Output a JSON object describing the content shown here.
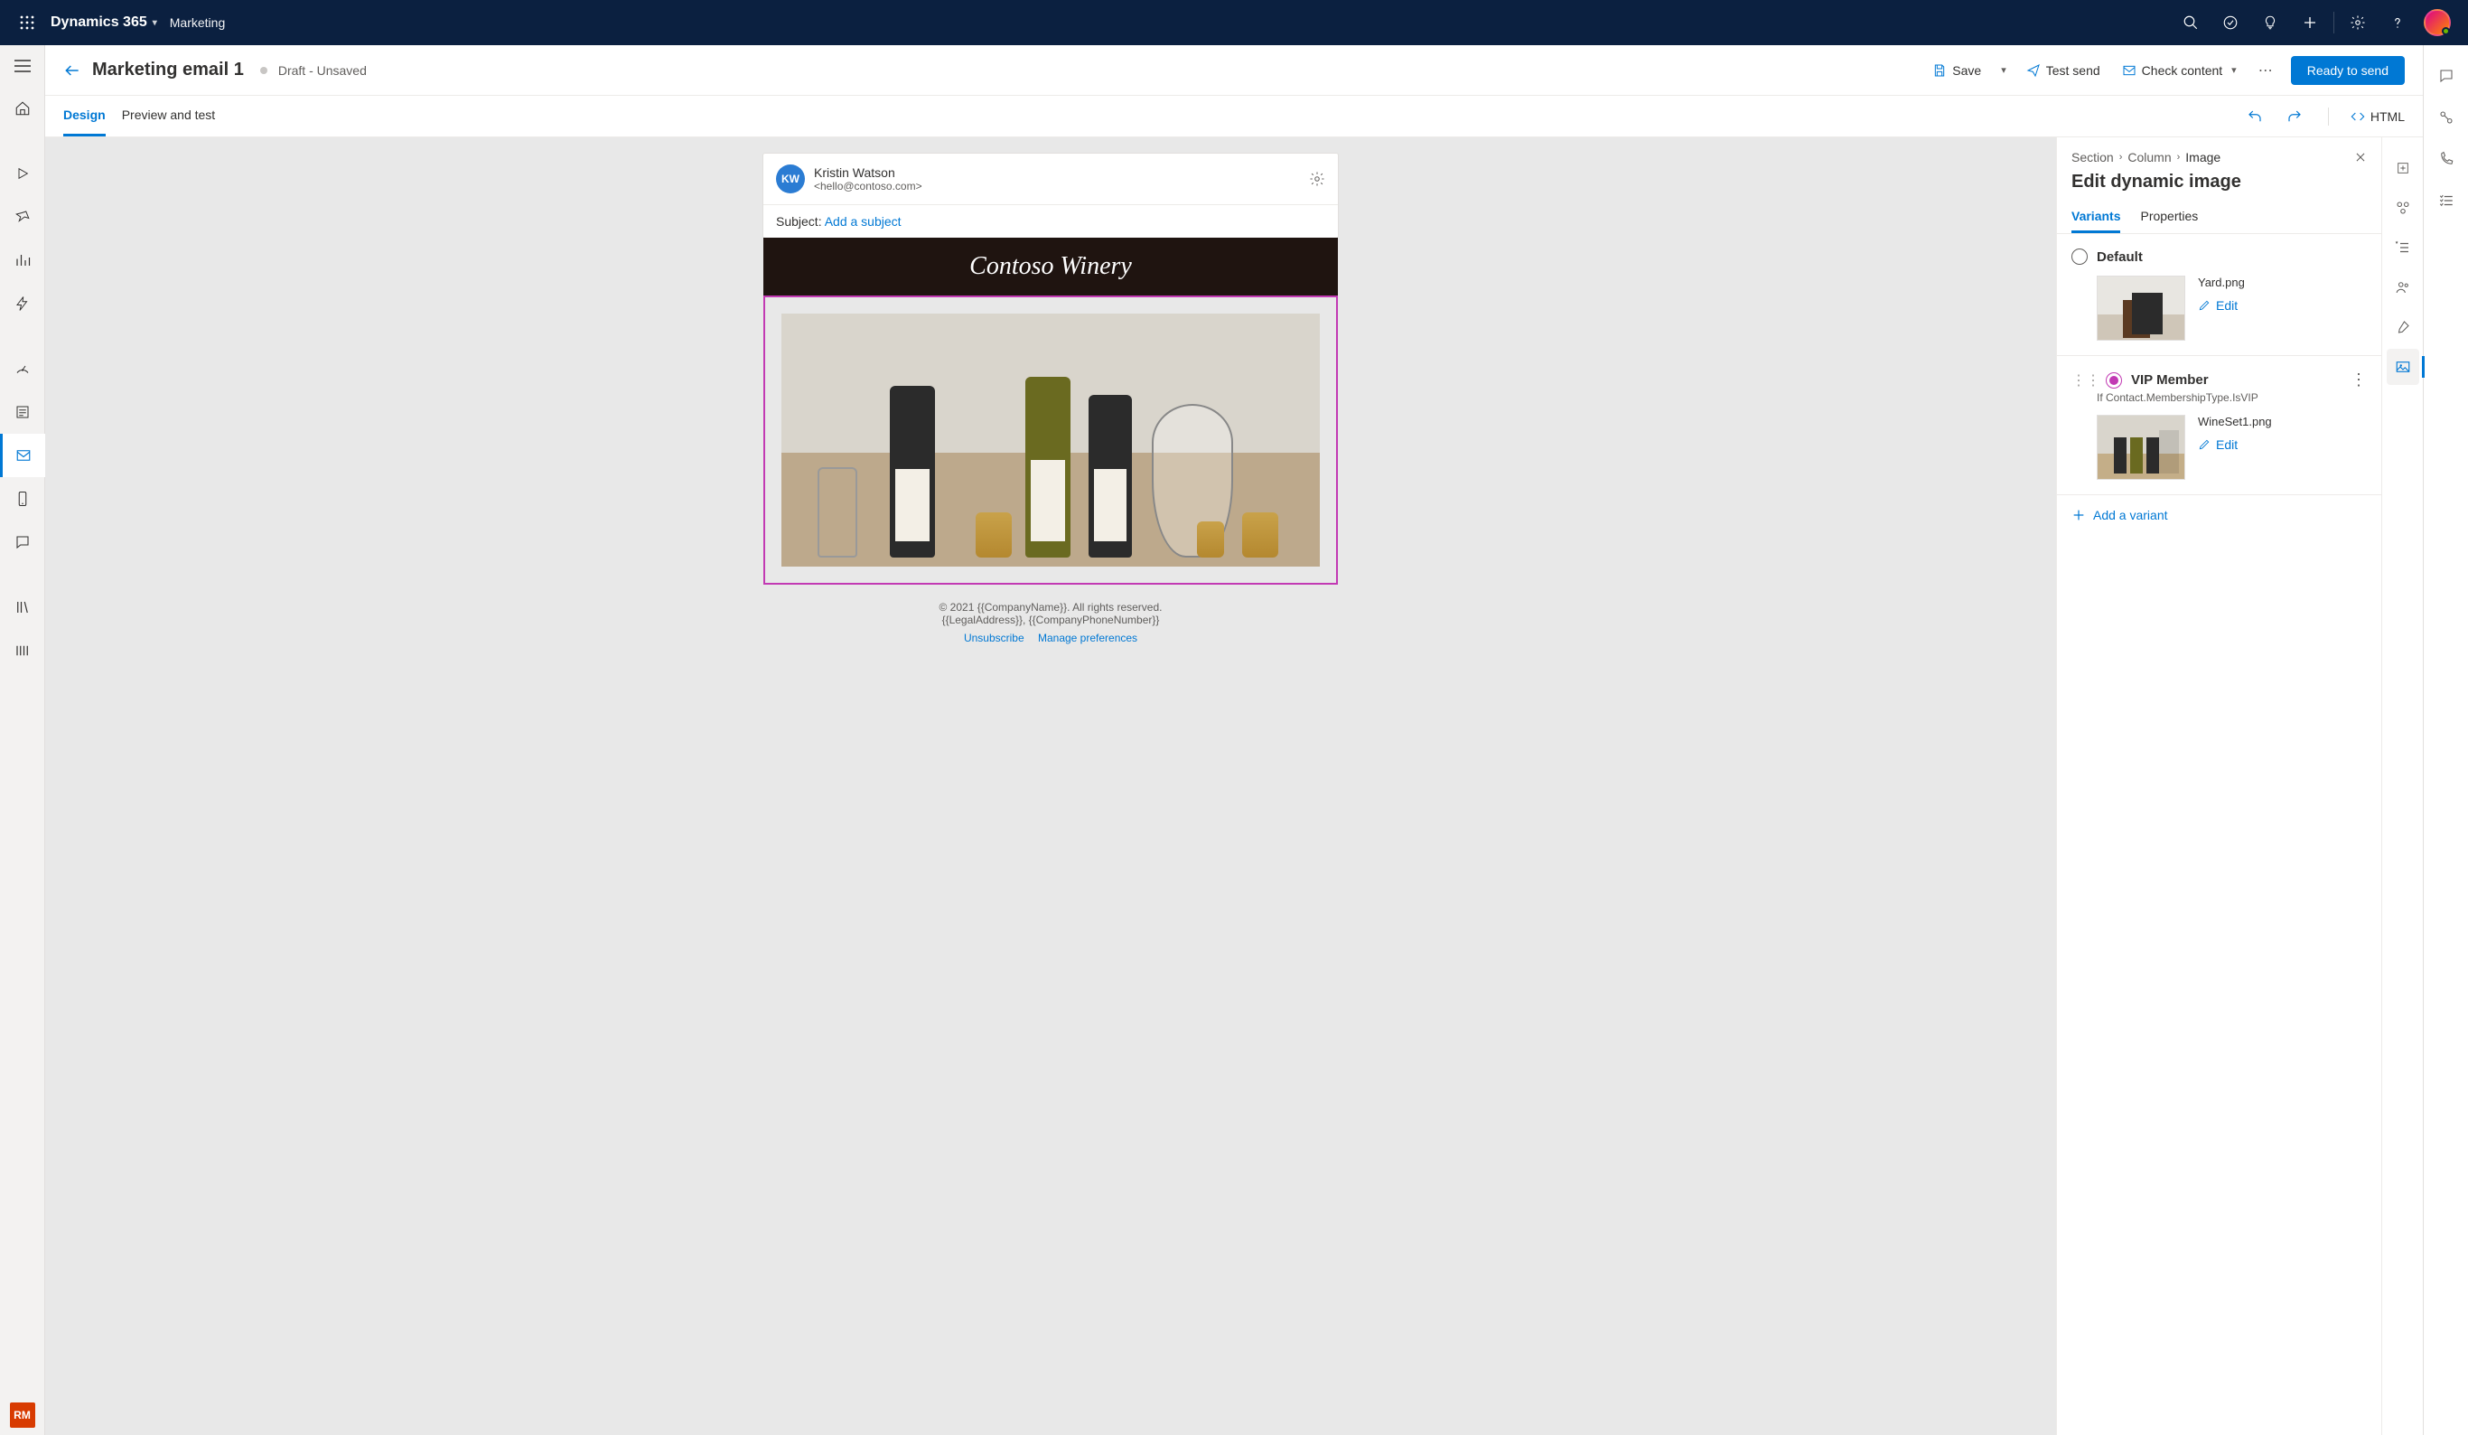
{
  "topnav": {
    "brand": "Dynamics 365",
    "area": "Marketing"
  },
  "leftrail": {
    "rm": "RM"
  },
  "cmdbar": {
    "title": "Marketing email 1",
    "status": "Draft - Unsaved",
    "save": "Save",
    "test_send": "Test send",
    "check_content": "Check content",
    "ready": "Ready to send"
  },
  "tabs": {
    "design": "Design",
    "preview": "Preview and test",
    "html": "HTML"
  },
  "email": {
    "avatar_initials": "KW",
    "sender_name": "Kristin Watson",
    "sender_email": "<hello@contoso.com>",
    "subject_label": "Subject: ",
    "subject_link": "Add a subject",
    "brand_title": "Contoso Winery",
    "footer_line1": "© 2021 {{CompanyName}}. All rights reserved.",
    "footer_line2": "{{LegalAddress}}, {{CompanyPhoneNumber}}",
    "unsubscribe": "Unsubscribe",
    "manage_prefs": "Manage preferences"
  },
  "proppane": {
    "bc_section": "Section",
    "bc_column": "Column",
    "bc_image": "Image",
    "heading": "Edit dynamic image",
    "tab_variants": "Variants",
    "tab_properties": "Properties",
    "add_variant": "Add a variant",
    "edit": "Edit",
    "variants": [
      {
        "title": "Default",
        "condition": "",
        "filename": "Yard.png",
        "selected": false
      },
      {
        "title": "VIP Member",
        "condition": "If Contact.MembershipType.IsVIP",
        "filename": "WineSet1.png",
        "selected": true
      }
    ]
  }
}
